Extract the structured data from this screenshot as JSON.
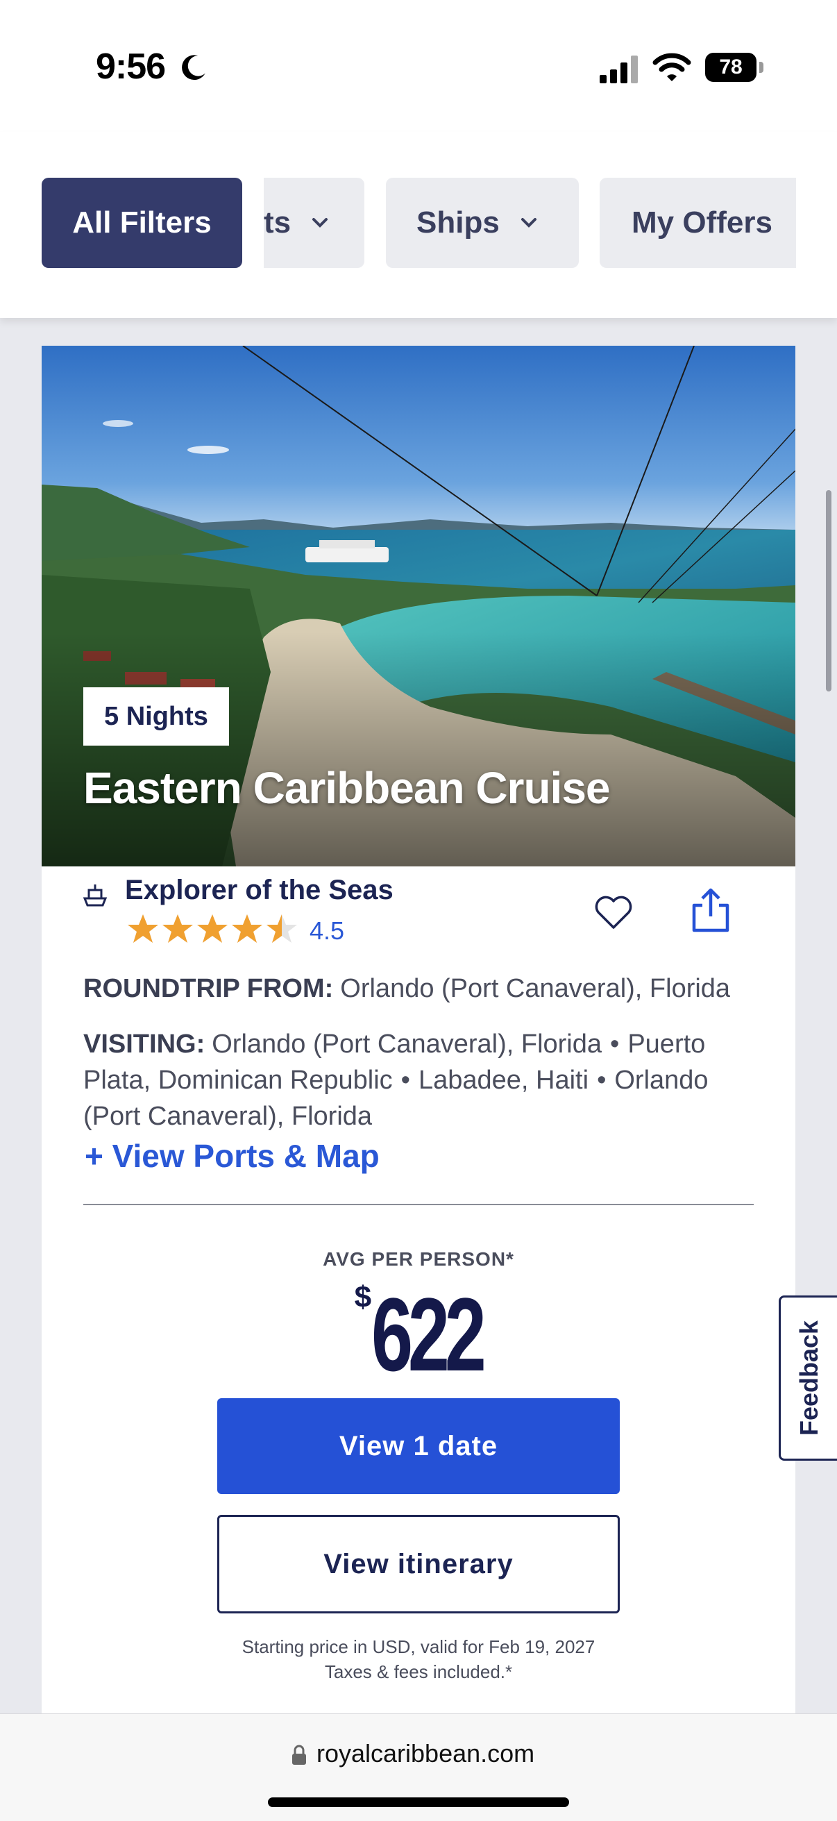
{
  "status_bar": {
    "time": "9:56",
    "battery": "78"
  },
  "filters": {
    "all_filters": "All Filters",
    "partial_filter": "ts",
    "ships": "Ships",
    "my_offers": "My Offers"
  },
  "card": {
    "nights": "5 Nights",
    "title": "Eastern Caribbean Cruise",
    "ship_name": "Explorer of the Seas",
    "rating": "4.5",
    "rating_value": 4.5,
    "roundtrip_label": "ROUNDTRIP FROM:",
    "roundtrip_value": "Orlando (Port Canaveral), Florida",
    "visiting_label": "VISITING:",
    "ports": [
      "Orlando (Port Canaveral), Florida",
      "Puerto Plata, Dominican Republic",
      "Labadee, Haiti",
      "Orlando (Port Canaveral), Florida"
    ],
    "port_separator": "•",
    "view_ports": "+ View Ports & Map",
    "avg_label": "AVG PER PERSON*",
    "currency_symbol": "$",
    "price": "622",
    "view_dates": "View 1 date",
    "view_itinerary": "View itinerary",
    "disclaimer_line1": "Starting price in USD, valid for Feb 19, 2027",
    "disclaimer_line2": "Taxes & fees included.*"
  },
  "feedback": "Feedback",
  "url_bar": {
    "domain": "royalcaribbean.com"
  },
  "colors": {
    "brand_navy": "#1c2453",
    "primary_blue": "#2551d6",
    "star_orange": "#f0a030",
    "all_filters_bg": "#343b6b"
  },
  "icons": [
    "moon-icon",
    "signal-icon",
    "wifi-icon",
    "battery-icon",
    "chevron-down-icon",
    "ship-icon",
    "star-icon",
    "heart-icon",
    "share-icon",
    "lock-icon"
  ]
}
